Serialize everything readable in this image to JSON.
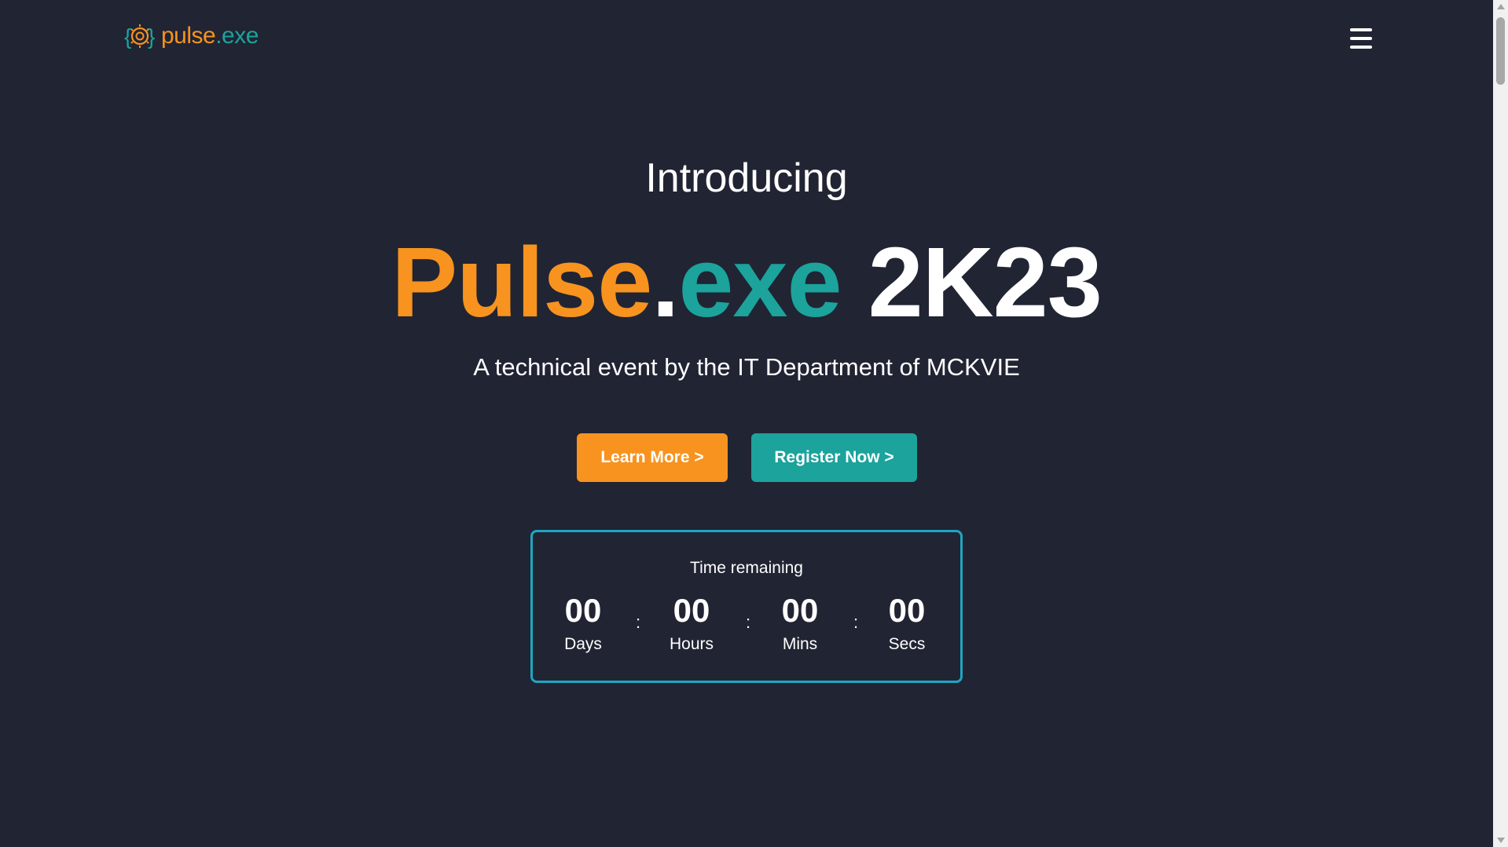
{
  "header": {
    "logo": {
      "word1": "pulse",
      "word2": ".exe"
    },
    "menu_icon": "hamburger-menu-icon"
  },
  "hero": {
    "intro": "Introducing",
    "title": {
      "part1": "Pulse",
      "part2": ".",
      "part3": "exe",
      "part4": "2K23"
    },
    "subtitle": "A technical event by the IT Department of MCKVIE",
    "buttons": {
      "learn_more": "Learn More >",
      "register_now": "Register Now >"
    }
  },
  "countdown": {
    "title": "Time remaining",
    "units": [
      {
        "value": "00",
        "label": "Days"
      },
      {
        "value": "00",
        "label": "Hours"
      },
      {
        "value": "00",
        "label": "Mins"
      },
      {
        "value": "00",
        "label": "Secs"
      }
    ],
    "separator": ":"
  },
  "colors": {
    "background": "#212433",
    "orange": "#f7931e",
    "teal": "#1ba39c",
    "countdown_border": "#1ea6c2",
    "text": "#ffffff"
  }
}
